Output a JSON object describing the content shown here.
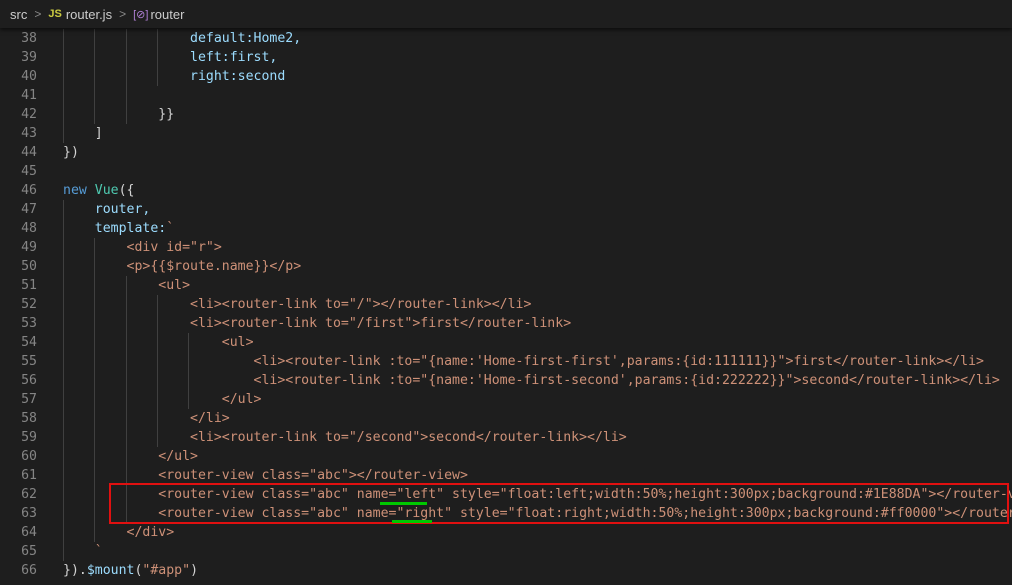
{
  "breadcrumb": {
    "items": [
      "src",
      "router.js",
      "router"
    ],
    "separator": ">",
    "js_badge": "JS",
    "symbol_glyph": "[⊘]"
  },
  "editor": {
    "lines": [
      {
        "num": "38",
        "tokens": [
          {
            "t": "                default:Home2,",
            "c": "var"
          }
        ]
      },
      {
        "num": "39",
        "tokens": [
          {
            "t": "                left:first,",
            "c": "var"
          }
        ]
      },
      {
        "num": "40",
        "tokens": [
          {
            "t": "                right:second",
            "c": "var"
          }
        ]
      },
      {
        "num": "41",
        "tokens": []
      },
      {
        "num": "42",
        "tokens": [
          {
            "t": "            }}",
            "c": "plain"
          }
        ]
      },
      {
        "num": "43",
        "tokens": [
          {
            "t": "    ]",
            "c": "plain"
          }
        ]
      },
      {
        "num": "44",
        "tokens": [
          {
            "t": "})",
            "c": "plain"
          }
        ]
      },
      {
        "num": "45",
        "tokens": []
      },
      {
        "num": "46",
        "tokens": [
          {
            "t": "new ",
            "c": "kw"
          },
          {
            "t": "Vue",
            "c": "cls"
          },
          {
            "t": "({",
            "c": "plain"
          }
        ]
      },
      {
        "num": "47",
        "tokens": [
          {
            "t": "    router,",
            "c": "var"
          }
        ]
      },
      {
        "num": "48",
        "tokens": [
          {
            "t": "    template:",
            "c": "var"
          },
          {
            "t": "`",
            "c": "str"
          }
        ]
      },
      {
        "num": "49",
        "tokens": [
          {
            "t": "        <div id=\"r\">",
            "c": "str"
          }
        ]
      },
      {
        "num": "50",
        "tokens": [
          {
            "t": "        <p>{{$route.name}}</p>",
            "c": "str"
          }
        ]
      },
      {
        "num": "51",
        "tokens": [
          {
            "t": "            <ul>",
            "c": "str"
          }
        ]
      },
      {
        "num": "52",
        "tokens": [
          {
            "t": "                <li><router-link to=\"/\"></router-link></li>",
            "c": "str"
          }
        ]
      },
      {
        "num": "53",
        "tokens": [
          {
            "t": "                <li><router-link to=\"/first\">first</router-link>",
            "c": "str"
          }
        ]
      },
      {
        "num": "54",
        "tokens": [
          {
            "t": "                    <ul>",
            "c": "str"
          }
        ]
      },
      {
        "num": "55",
        "tokens": [
          {
            "t": "                        <li><router-link :to=\"{name:'Home-first-first',params:{id:111111}}\">first</router-link></li>",
            "c": "str"
          }
        ]
      },
      {
        "num": "56",
        "tokens": [
          {
            "t": "                        <li><router-link :to=\"{name:'Home-first-second',params:{id:222222}}\">second</router-link></li>",
            "c": "str"
          }
        ]
      },
      {
        "num": "57",
        "tokens": [
          {
            "t": "                    </ul>",
            "c": "str"
          }
        ]
      },
      {
        "num": "58",
        "tokens": [
          {
            "t": "                </li>",
            "c": "str"
          }
        ]
      },
      {
        "num": "59",
        "tokens": [
          {
            "t": "                <li><router-link to=\"/second\">second</router-link></li>",
            "c": "str"
          }
        ]
      },
      {
        "num": "60",
        "tokens": [
          {
            "t": "            </ul>",
            "c": "str"
          }
        ]
      },
      {
        "num": "61",
        "tokens": [
          {
            "t": "            <router-view class=\"abc\"></router-view>",
            "c": "str"
          }
        ]
      },
      {
        "num": "62",
        "tokens": [
          {
            "t": "            <router-view class=\"abc\" name=\"left\" style=\"float:left;width:50%;height:300px;background:#1E88DA\"></router-view>",
            "c": "str"
          }
        ]
      },
      {
        "num": "63",
        "tokens": [
          {
            "t": "            <router-view class=\"abc\" name=\"right\" style=\"float:right;width:50%;height:300px;background:#ff0000\"></router-view>",
            "c": "str"
          }
        ]
      },
      {
        "num": "64",
        "tokens": [
          {
            "t": "        </div>",
            "c": "str"
          }
        ]
      },
      {
        "num": "65",
        "tokens": [
          {
            "t": "    `",
            "c": "str"
          }
        ]
      },
      {
        "num": "66",
        "tokens": [
          {
            "t": "}).",
            "c": "plain"
          },
          {
            "t": "$mount",
            "c": "var"
          },
          {
            "t": "(",
            "c": "plain"
          },
          {
            "t": "\"#app\"",
            "c": "str"
          },
          {
            "t": ")",
            "c": "plain"
          }
        ]
      }
    ]
  },
  "colors": {
    "background": "#1e1e1e",
    "line_number": "#858585",
    "keyword": "#569cd6",
    "class": "#4ec9b0",
    "string": "#ce9178",
    "variable": "#9cdcfe",
    "highlight_border": "#e01010",
    "underline": "#00c800"
  }
}
